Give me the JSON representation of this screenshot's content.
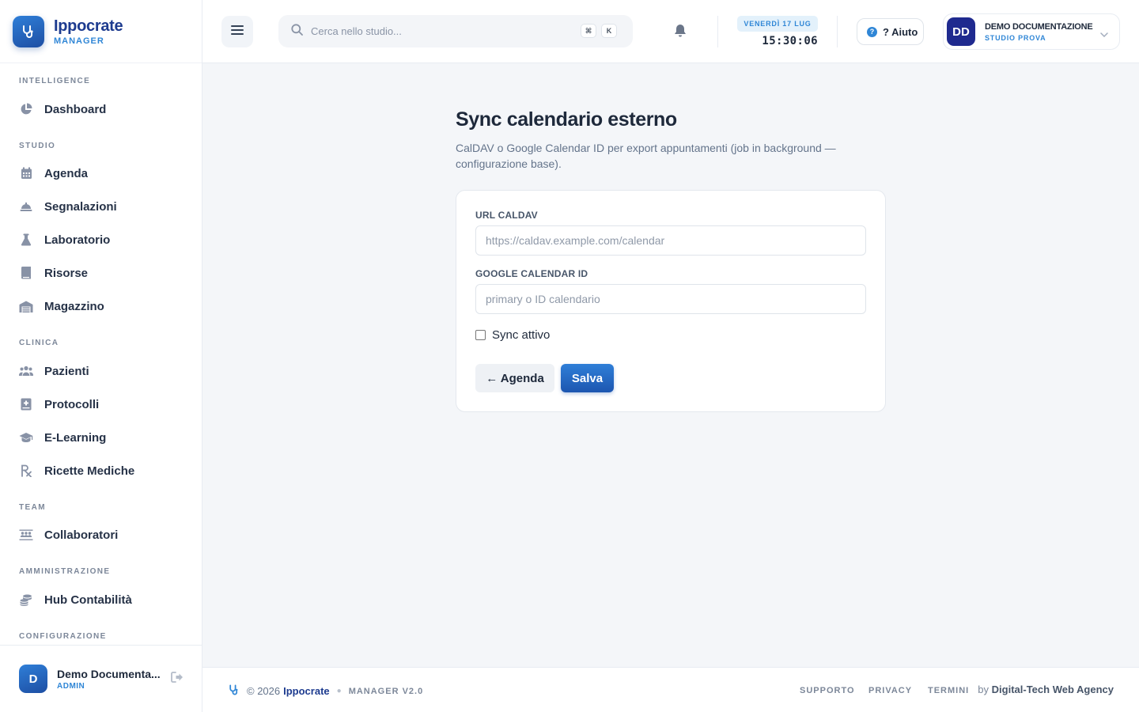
{
  "brand": {
    "name": "Ippocrate",
    "sub": "MANAGER"
  },
  "sidebar": {
    "sections": [
      {
        "title": "INTELLIGENCE",
        "items": [
          {
            "label": "Dashboard",
            "icon": "chart-pie-icon"
          }
        ]
      },
      {
        "title": "STUDIO",
        "items": [
          {
            "label": "Agenda",
            "icon": "calendar-icon"
          },
          {
            "label": "Segnalazioni",
            "icon": "bell-service-icon"
          },
          {
            "label": "Laboratorio",
            "icon": "flask-icon"
          },
          {
            "label": "Risorse",
            "icon": "book-icon"
          },
          {
            "label": "Magazzino",
            "icon": "warehouse-icon"
          }
        ]
      },
      {
        "title": "CLINICA",
        "items": [
          {
            "label": "Pazienti",
            "icon": "users-icon"
          },
          {
            "label": "Protocolli",
            "icon": "medical-book-icon"
          },
          {
            "label": "E-Learning",
            "icon": "graduation-cap-icon"
          },
          {
            "label": "Ricette Mediche",
            "icon": "prescription-icon"
          }
        ]
      },
      {
        "title": "TEAM",
        "items": [
          {
            "label": "Collaboratori",
            "icon": "people-group-icon"
          }
        ]
      },
      {
        "title": "AMMINISTRAZIONE",
        "items": [
          {
            "label": "Hub Contabilità",
            "icon": "coins-icon"
          }
        ]
      },
      {
        "title": "CONFIGURAZIONE",
        "items": []
      }
    ],
    "user": {
      "initial": "D",
      "name": "Demo Documenta...",
      "role": "ADMIN"
    }
  },
  "topbar": {
    "search_placeholder": "Cerca nello studio...",
    "kbd1": "⌘",
    "kbd2": "K",
    "date": "VENERDÌ 17 LUG",
    "time": "15:30:06",
    "help_label": "? Aiuto",
    "profile": {
      "initials": "DD",
      "name": "DEMO DOCUMENTAZIONE",
      "sub": "STUDIO PROVA"
    }
  },
  "main": {
    "title": "Sync calendario esterno",
    "description": "CalDAV o Google Calendar ID per export appuntamenti (job in background — configurazione base).",
    "form": {
      "caldav_label": "URL CALDAV",
      "caldav_placeholder": "https://caldav.example.com/calendar",
      "caldav_value": "",
      "google_label": "GOOGLE CALENDAR ID",
      "google_placeholder": "primary o ID calendario",
      "google_value": "",
      "sync_label": "Sync attivo",
      "sync_checked": false,
      "back_label": "← Agenda",
      "save_label": "Salva"
    }
  },
  "footer": {
    "copyright": "© 2026",
    "brand": "Ippocrate",
    "version": "MANAGER V2.0",
    "links": [
      "SUPPORTO",
      "PRIVACY",
      "TERMINI"
    ],
    "by_prefix": "by",
    "agency": "Digital-Tech Web Agency"
  },
  "colors": {
    "accent": "#2f86d6",
    "brand": "#1d3b8f",
    "background": "#f4f6f9"
  }
}
